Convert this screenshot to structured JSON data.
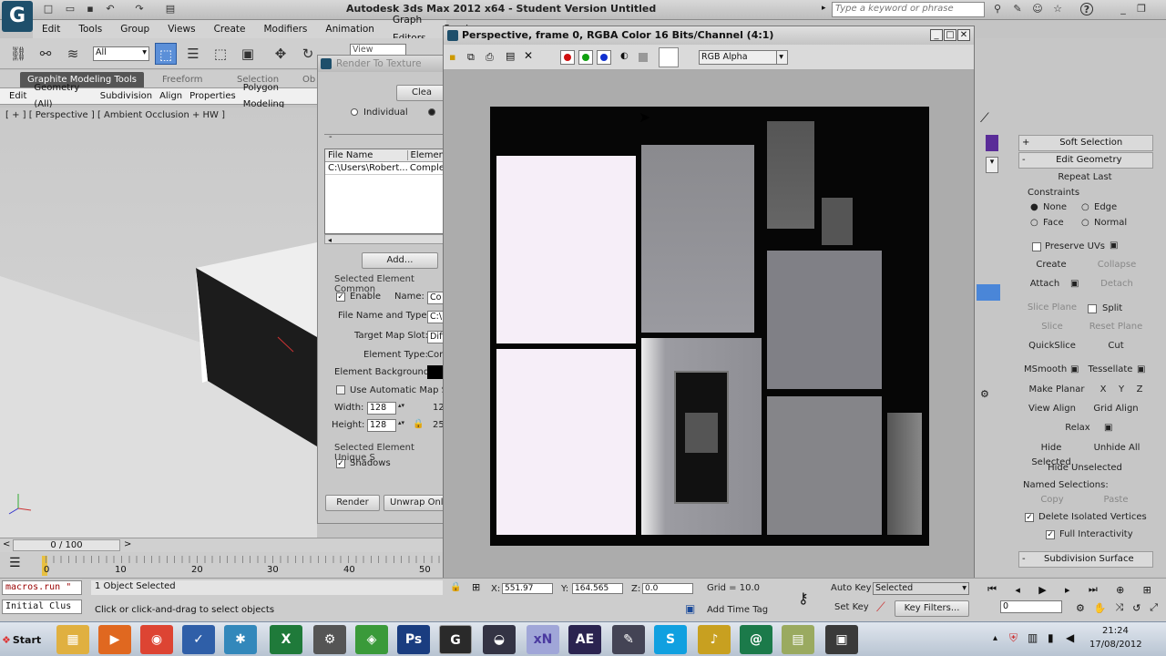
{
  "app": {
    "title": "Autodesk 3ds Max  2012 x64  - Student Version   Untitled",
    "search_placeholder": "Type a keyword or phrase",
    "logo": "G"
  },
  "menu": [
    "Edit",
    "Tools",
    "Group",
    "Views",
    "Create",
    "Modifiers",
    "Animation",
    "Graph Editors",
    "Rende"
  ],
  "toolbar": {
    "selection_filter": "All",
    "view_dropdown": "View"
  },
  "ribbon": {
    "tabs": [
      "Graphite Modeling Tools",
      "Freeform",
      "Selection",
      "Ob"
    ],
    "items": [
      "Edit",
      "Geometry (All)",
      "Subdivision",
      "Align",
      "Properties",
      "Polygon Modeling"
    ]
  },
  "viewport": {
    "label": "[ + ] [ Perspective ] [ Ambient Occlusion + HW ]"
  },
  "rtt": {
    "title": "Render To Texture",
    "clear": "Clea",
    "individual": "Individual",
    "list_headers": [
      "File Name",
      "Elemen"
    ],
    "list_row": [
      "C:\\Users\\Robert...",
      "Comple"
    ],
    "add": "Add...",
    "group1": "Selected Element Common",
    "enable": "Enable",
    "name_label": "Name:",
    "name_value": "Co",
    "file_label": "File Name and Type:",
    "file_value": "C:\\",
    "slot_label": "Target Map Slot:",
    "slot_value": "Diff",
    "type_label": "Element Type:",
    "type_value": "Cor",
    "bg_label": "Element Background:",
    "auto_map": "Use Automatic Map Siz",
    "width_label": "Width:",
    "width_value": "128",
    "width2": "12",
    "height_label": "Height:",
    "height_value": "128",
    "height2": "25",
    "group2": "Selected Element Unique S",
    "shadows": "Shadows",
    "render": "Render",
    "unwrap": "Unwrap Only"
  },
  "framebuffer": {
    "title": "Perspective, frame 0, RGBA Color 16 Bits/Channel (4:1)",
    "channel": "RGB Alpha",
    "colors": {
      "red": "#d01010",
      "green": "#10a010",
      "blue": "#1030d0"
    }
  },
  "command_panel": {
    "soft_selection": "Soft Selection",
    "edit_geometry": "Edit Geometry",
    "repeat_last": "Repeat Last",
    "constraints": "Constraints",
    "none": "None",
    "edge": "Edge",
    "face": "Face",
    "normal": "Normal",
    "preserve_uvs": "Preserve UVs",
    "create": "Create",
    "collapse": "Collapse",
    "attach": "Attach",
    "detach": "Detach",
    "slice_plane": "Slice Plane",
    "split": "Split",
    "slice": "Slice",
    "reset_plane": "Reset Plane",
    "quickslice": "QuickSlice",
    "cut": "Cut",
    "msmooth": "MSmooth",
    "tessellate": "Tessellate",
    "make_planar": "Make Planar",
    "x": "X",
    "y": "Y",
    "z": "Z",
    "view_align": "View Align",
    "grid_align": "Grid Align",
    "relax": "Relax",
    "hide_selected": "Hide Selected",
    "unhide_all": "Unhide All",
    "hide_unselected": "Hide Unselected",
    "named_selections": "Named Selections:",
    "copy": "Copy",
    "paste": "Paste",
    "delete_isolated": "Delete Isolated Vertices",
    "full_interactivity": "Full Interactivity",
    "subdivision_surface": "Subdivision Surface"
  },
  "timeline": {
    "frame": "0 / 100",
    "ticks": [
      "0",
      "10",
      "20",
      "30",
      "40",
      "50"
    ]
  },
  "status": {
    "maxscript1": "macros.run \"",
    "maxscript2": "Initial Clus",
    "selected": "1 Object Selected",
    "prompt": "Click or click-and-drag to select objects",
    "x_label": "X:",
    "x_value": "551.97",
    "y_label": "Y:",
    "y_value": "164.565",
    "z_label": "Z:",
    "z_value": "0.0",
    "grid": "Grid = 10.0",
    "add_time_tag": "Add Time Tag",
    "auto_key": "Auto Key",
    "set_key": "Set Key",
    "selected_dropdown": "Selected",
    "key_filters": "Key Filters...",
    "frame_field": "0"
  },
  "taskbar": {
    "start": "Start",
    "time": "21:24",
    "date": "17/08/2012",
    "apps": [
      "Explorer",
      "Media",
      "Chrome",
      "Tasks",
      "Maya",
      "Excel",
      "Gear",
      "Android",
      "Ps",
      "3ds",
      "Blender",
      "xN",
      "AE",
      "Pen",
      "Skype",
      "Music",
      "Swirl",
      "Notes",
      "Film"
    ]
  }
}
